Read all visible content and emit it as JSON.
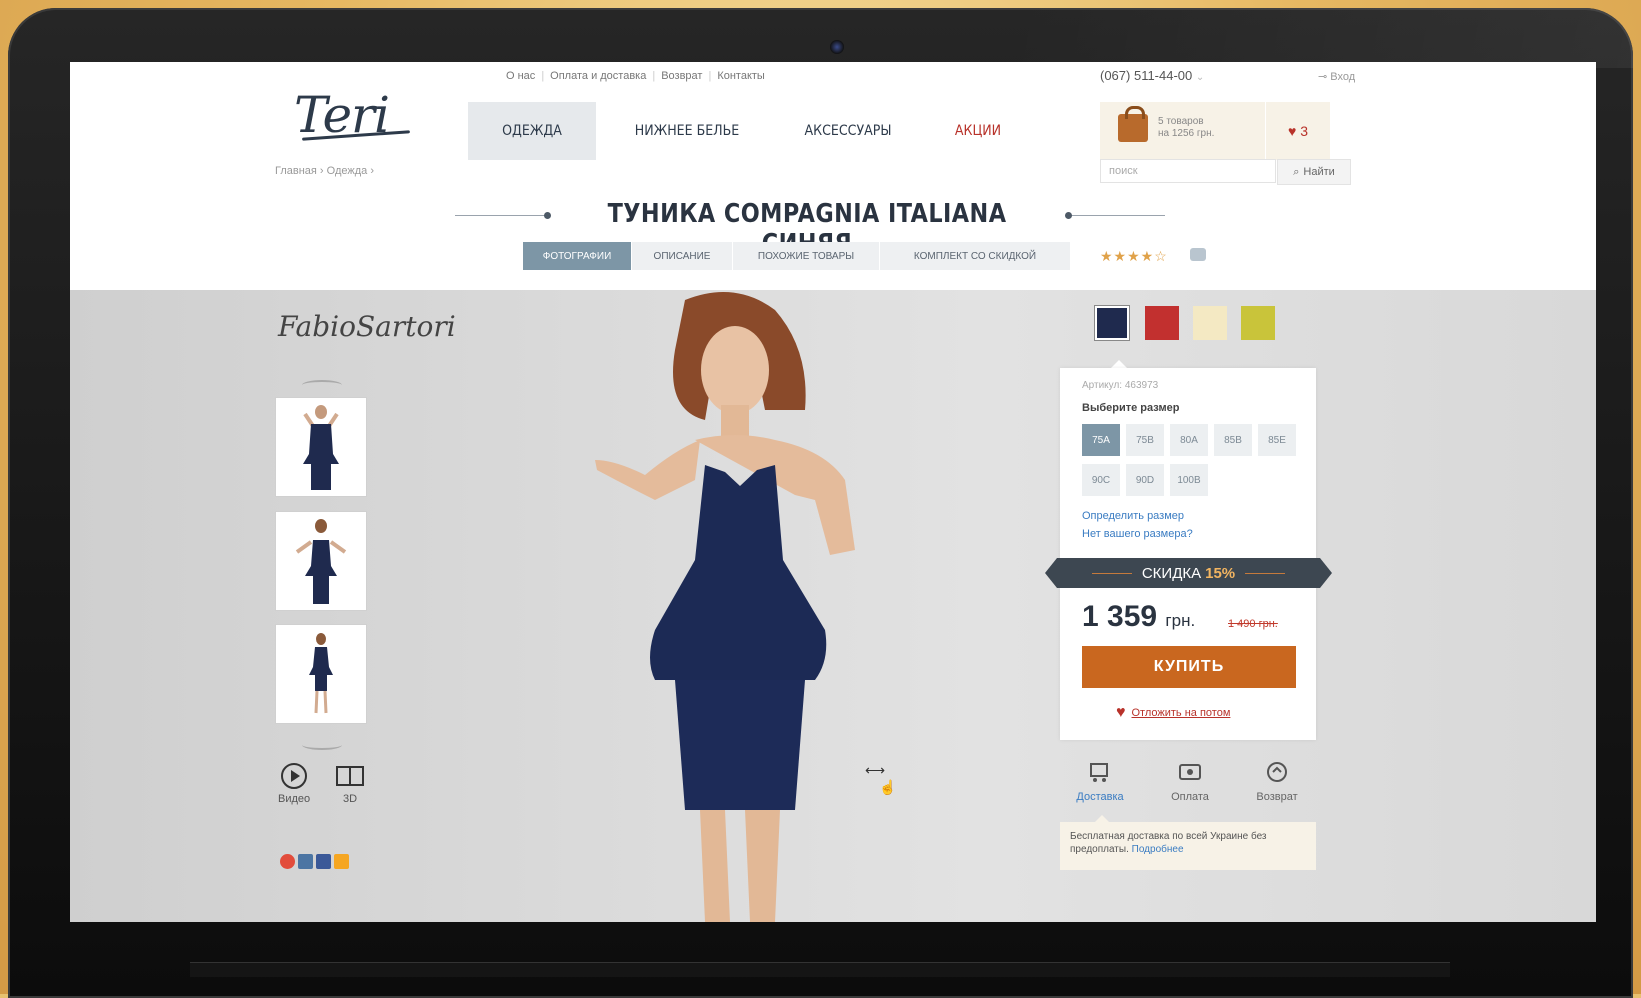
{
  "topnav": {
    "about": "О нас",
    "payment": "Оплата и доставка",
    "returns": "Возврат",
    "contacts": "Контакты"
  },
  "header": {
    "phone": "(067) 511-44-00",
    "login": "Вход",
    "logo": "Teri"
  },
  "mainnav": [
    {
      "label": "ОДЕЖДА"
    },
    {
      "label": "НИЖНЕЕ БЕЛЬЕ"
    },
    {
      "label": "АКСЕССУАРЫ"
    },
    {
      "label": "АКЦИИ"
    }
  ],
  "cart": {
    "line1": "5 товаров",
    "line2": "на 1256 грн.",
    "wishlist_count": "3"
  },
  "breadcrumb": {
    "home": "Главная",
    "current": "Одежда"
  },
  "search": {
    "placeholder": "поиск",
    "button": "Найти"
  },
  "product": {
    "title": "ТУНИКА COMPAGNIA ITALIANA СИНЯЯ",
    "tabs": [
      "ФОТОГРАФИИ",
      "ОПИСАНИЕ",
      "ПОХОЖИЕ ТОВАРЫ",
      "КОМПЛЕКТ СО СКИДКОЙ"
    ],
    "stars": "★★★★☆",
    "rating": 4,
    "brand": "FabioSartori",
    "sku": "Артикул: 463973",
    "choose_size": "Выберите размер",
    "sizes": [
      "75A",
      "75B",
      "80A",
      "85B",
      "85E",
      "90C",
      "90D",
      "100B"
    ],
    "link_size": "Определить размер",
    "link_no_size": "Нет вашего размера?",
    "discount_label": "СКИДКА",
    "discount_value": "15%",
    "price": "1 359",
    "currency": "грн.",
    "old_price": "1 490 грн.",
    "buy": "КУПИТЬ",
    "later": "Отложить на потом"
  },
  "colors": [
    "#1f2a4e",
    "#c2302f",
    "#f4e9c3",
    "#c9c43a"
  ],
  "media": {
    "video": "Видео",
    "3d": "3D"
  },
  "services": {
    "delivery": "Доставка",
    "payment": "Оплата",
    "returns": "Возврат"
  },
  "delivery_note": {
    "text": "Бесплатная доставка по всей Украине без предоплаты.",
    "link": "Подробнее"
  }
}
